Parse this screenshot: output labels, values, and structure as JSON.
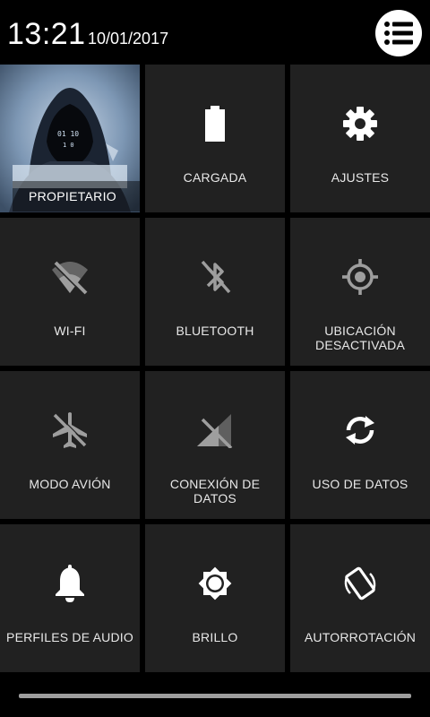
{
  "status": {
    "time": "13:21",
    "date": "10/01/2017"
  },
  "menu": {
    "icon": "list-menu-icon"
  },
  "tiles": [
    {
      "label": "PROPIETARIO",
      "icon": "owner-photo"
    },
    {
      "label": "CARGADA",
      "icon": "battery-full-icon"
    },
    {
      "label": "AJUSTES",
      "icon": "gear-icon"
    },
    {
      "label": "WI-FI",
      "icon": "wifi-off-icon"
    },
    {
      "label": "BLUETOOTH",
      "icon": "bluetooth-off-icon"
    },
    {
      "label": "UBICACIÓN DESACTIVADA",
      "icon": "location-icon"
    },
    {
      "label": "MODO AVIÓN",
      "icon": "airplane-icon"
    },
    {
      "label": "CONEXIÓN DE DATOS",
      "icon": "mobile-data-off-icon"
    },
    {
      "label": "USO DE DATOS",
      "icon": "sync-icon"
    },
    {
      "label": "PERFILES DE AUDIO",
      "icon": "bell-icon"
    },
    {
      "label": "BRILLO",
      "icon": "brightness-icon"
    },
    {
      "label": "AUTORROTACIÓN",
      "icon": "screen-rotation-icon"
    }
  ],
  "colors": {
    "tile_bg": "#212121",
    "active_icon": "#ffffff",
    "inactive_icon": "#9e9e9e"
  }
}
